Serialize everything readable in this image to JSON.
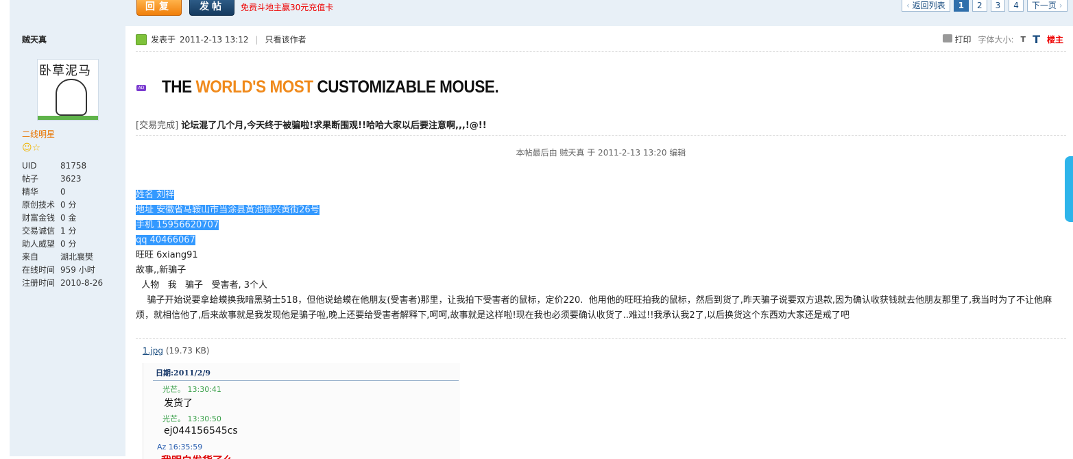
{
  "toolbar": {
    "reply_label": "回复",
    "post_label": "发帖",
    "promo_text": "免费斗地主赢30元充值卡"
  },
  "pager": {
    "back_label": "返回列表",
    "pages": [
      "1",
      "2",
      "3",
      "4"
    ],
    "current_page": "1",
    "next_label": "下一页"
  },
  "author": {
    "name": "贼天真",
    "avatar_text": "卧草泥马",
    "rank": "二线明星",
    "stats": [
      {
        "label": "UID",
        "value": "81758"
      },
      {
        "label": "帖子",
        "value": "3623"
      },
      {
        "label": "精华",
        "value": "0"
      },
      {
        "label": "原创技术",
        "value": "0 分"
      },
      {
        "label": "财富金钱",
        "value": "0 金"
      },
      {
        "label": "交易诚信",
        "value": "1 分"
      },
      {
        "label": "助人威望",
        "value": "0 分"
      },
      {
        "label": "来自",
        "value": "湖北襄樊"
      },
      {
        "label": "在线时间",
        "value": "959 小时"
      },
      {
        "label": "注册时间",
        "value": "2010-8-26"
      }
    ]
  },
  "post": {
    "posted_prefix": "发表于",
    "posted_time": "2011-2-13 13:12",
    "only_author_label": "只看该作者",
    "print_label": "打印",
    "font_size_label": "字体大小:",
    "font_small": "T",
    "font_large": "T",
    "floor_label": "楼主",
    "ad_badge": "AD",
    "ad_text_pre": "THE ",
    "ad_text_hl": "WORLD'S MOST",
    "ad_text_post": " CUSTOMIZABLE MOUSE.",
    "tag": "[交易完成]",
    "title": "论坛混了几个月,今天终于被骗啦!求果断围观!!哈哈大家以后要注意啊,,,!@!!",
    "edit_note": "本帖最后由 贼天真 于 2011-2-13 13:20 编辑",
    "body_lines": [
      "姓名 刘祥 ",
      "地址 安徽省马鞍山市当涂县黄池镇兴黄街26号 ",
      "手机 15956620707 ",
      "qq   40466067"
    ],
    "wangwang": "旺旺 6xiang91",
    "story_intro": "故事,,新骗子",
    "cast": "  人物   我   骗子   受害者, 3个人",
    "story": "    骗子开始说要拿蛤蟆换我暗黑骑士518，但他说蛤蟆在他朋友(受害者)那里，让我拍下受害者的鼠标，定价220.  他用他的旺旺拍我的鼠标，然后到货了,昨天骗子说要双方退款,因为确认收获钱就去他朋友那里了,我当时为了不让他麻烦，就相信他了,后来故事就是我发现他是骗子啦,晚上还要给受害者解释下,呵呵,故事就是这样啦!现在我也必须要确认收货了..难过!!我承认我2了,以后换货这个东西劝大家还是戒了吧",
    "attachment_name": "1.jpg",
    "attachment_size": "(19.73 KB)"
  },
  "chat": {
    "date_label": "日期:2011/2/9",
    "messages": [
      {
        "sender": "光芒。 13:30:41",
        "text": "发货了"
      },
      {
        "sender": "光芒。 13:30:50",
        "text": "ej044156545cs"
      }
    ],
    "last_sender": "Az 16:35:59",
    "last_text": "我明白发货了么"
  },
  "colors": {
    "sidebar_bg": "#e8f0f7",
    "accent": "#1a4d80",
    "selection": "#3399ff",
    "warning": "#e00000"
  },
  "icons": [
    "online-icon",
    "print-icon",
    "smiley-icon",
    "star-icon"
  ]
}
